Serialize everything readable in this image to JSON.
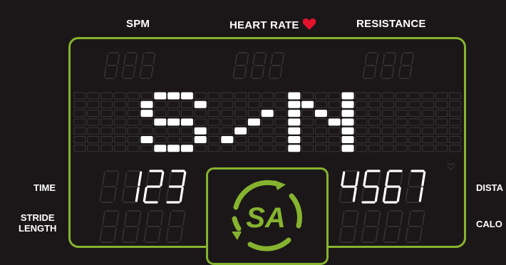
{
  "headers": {
    "spm": "SPM",
    "heart_rate": "HEART RATE",
    "resistance": "RESISTANCE"
  },
  "labels": {
    "time": "TIME",
    "stride_line1": "STRIDE",
    "stride_line2": "LENGTH",
    "distance": "DISTA",
    "calories": "CALO"
  },
  "dot_matrix_text": "S-N",
  "time_display": "123",
  "distance_display": "4567",
  "logo_text": "SA",
  "colors": {
    "accent": "#86b32f",
    "background": "#1b1718",
    "heart": "#e3122b",
    "lit": "#ffffff",
    "unlit": "#3a3637"
  }
}
